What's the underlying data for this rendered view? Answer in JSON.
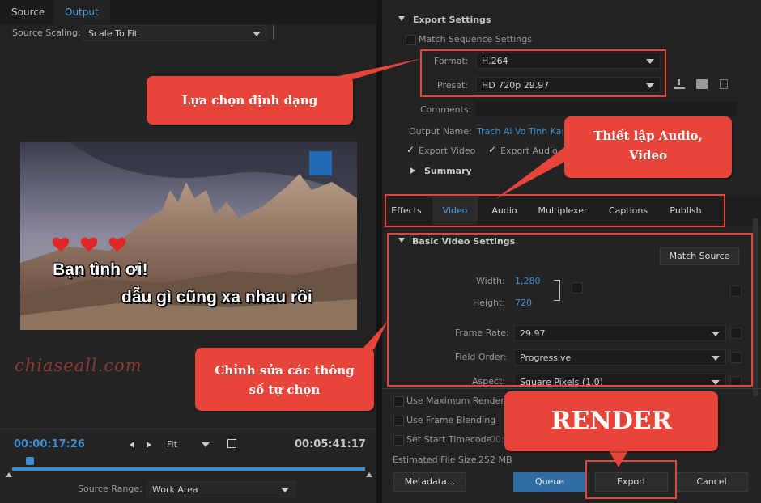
{
  "source_panel": {
    "tabs": [
      {
        "label": "Source"
      },
      {
        "label": "Output"
      }
    ],
    "scaling_label": "Source Scaling:",
    "scaling_value": "Scale To Fit",
    "overlay_lines": [
      "Bạn tình ơi!",
      "dẫu gì cũng xa nhau rồi"
    ],
    "watermark": "chiaseall.com",
    "current_time": "00:00:17:26",
    "zoom": "Fit",
    "duration": "00:05:41:17",
    "source_range_label": "Source Range:",
    "source_range_value": "Work Area",
    "playhead_fraction": 0.05
  },
  "export_settings": {
    "section_title": "Export Settings",
    "match_sequence_label": "Match Sequence Settings",
    "format_label": "Format:",
    "format_value": "H.264",
    "preset_label": "Preset:",
    "preset_value": "HD 720p 29.97",
    "comments_label": "Comments:",
    "output_name_label": "Output Name:",
    "output_name_value": "Trach Ai Vo Tinh Kara",
    "export_video_label": "Export Video",
    "export_audio_label": "Export Audio",
    "summary_label": "Summary"
  },
  "subtabs": [
    {
      "label": "Effects"
    },
    {
      "label": "Video"
    },
    {
      "label": "Audio"
    },
    {
      "label": "Multiplexer"
    },
    {
      "label": "Captions"
    },
    {
      "label": "Publish"
    }
  ],
  "video_settings": {
    "section_title": "Basic Video Settings",
    "match_source_label": "Match Source",
    "width_label": "Width:",
    "width_value": "1,280",
    "height_label": "Height:",
    "height_value": "720",
    "frame_rate_label": "Frame Rate:",
    "frame_rate_value": "29.97",
    "field_order_label": "Field Order:",
    "field_order_value": "Progressive",
    "aspect_label": "Aspect:",
    "aspect_value": "Square Pixels (1.0)"
  },
  "bottom": {
    "max_render_label": "Use Maximum Render Q",
    "frame_blending_label": "Use Frame Blending",
    "start_timecode_label": "Set Start Timecode",
    "start_timecode_value": "00:0",
    "file_size_label": "Estimated File Size:",
    "file_size_value": "252 MB",
    "metadata_label": "Metadata...",
    "queue_label": "Queue",
    "export_label": "Export",
    "cancel_label": "Cancel"
  },
  "callouts": {
    "format": "Lựa chọn định dạng",
    "audio_video": "Thiết lập Audio, Video",
    "params": "Chỉnh sửa các thông số tự chọn",
    "render": "RENDER"
  },
  "colors": {
    "accent": "#3f8fd0",
    "callout": "#e8453a",
    "queue": "#2f6ea3"
  }
}
